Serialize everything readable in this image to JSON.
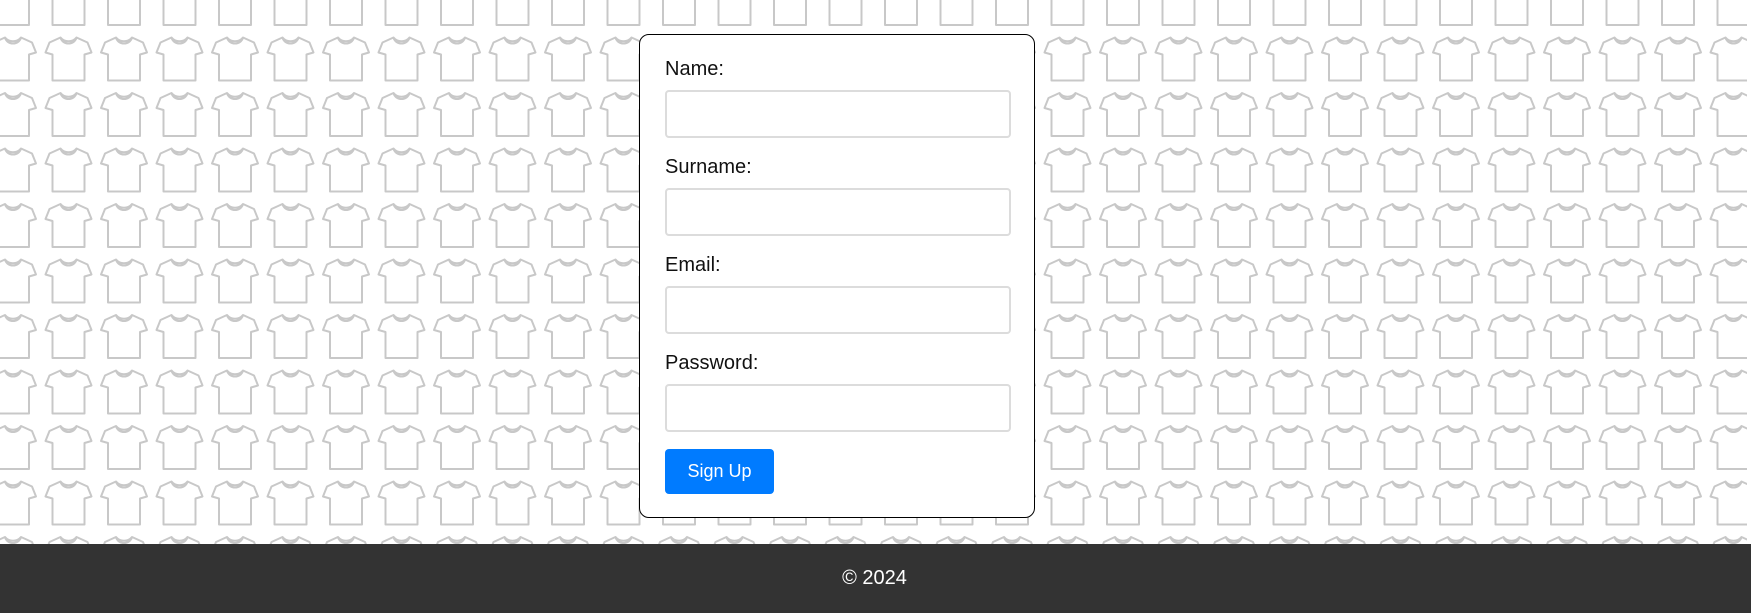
{
  "background": {
    "icon": "tshirt-icon",
    "tile_color": "#c8c8c8"
  },
  "form": {
    "fields": [
      {
        "label": "Name:",
        "value": "",
        "placeholder": ""
      },
      {
        "label": "Surname:",
        "value": "",
        "placeholder": ""
      },
      {
        "label": "Email:",
        "value": "",
        "placeholder": ""
      },
      {
        "label": "Password:",
        "value": "",
        "placeholder": ""
      }
    ],
    "submit_label": "Sign Up",
    "submit_color": "#007bff"
  },
  "footer": {
    "text": "© 2024",
    "background": "#333333"
  }
}
